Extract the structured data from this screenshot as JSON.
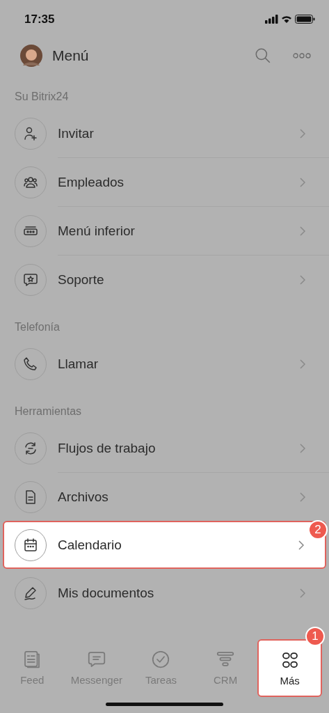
{
  "status_bar": {
    "time": "17:35"
  },
  "header": {
    "title": "Menú"
  },
  "sections": [
    {
      "title": "Su Bitrix24",
      "items": [
        {
          "label": "Invitar",
          "kind": "invite",
          "highlighted": false
        },
        {
          "label": "Empleados",
          "kind": "people",
          "highlighted": false
        },
        {
          "label": "Menú inferior",
          "kind": "bar",
          "highlighted": false
        },
        {
          "label": "Soporte",
          "kind": "support",
          "highlighted": false
        }
      ]
    },
    {
      "title": "Telefonía",
      "items": [
        {
          "label": "Llamar",
          "kind": "phone",
          "highlighted": false
        }
      ]
    },
    {
      "title": "Herramientas",
      "items": [
        {
          "label": "Flujos de trabajo",
          "kind": "flow",
          "highlighted": false
        },
        {
          "label": "Archivos",
          "kind": "file",
          "highlighted": false
        },
        {
          "label": "Calendario",
          "kind": "calendar",
          "highlighted": true,
          "badge": "2"
        },
        {
          "label": "Mis documentos",
          "kind": "sign",
          "highlighted": false
        }
      ]
    }
  ],
  "tabs": [
    {
      "label": "Feed",
      "kind": "feed",
      "selected": false,
      "highlighted": false
    },
    {
      "label": "Messenger",
      "kind": "chat",
      "selected": false,
      "highlighted": false
    },
    {
      "label": "Tareas",
      "kind": "check",
      "selected": false,
      "highlighted": false
    },
    {
      "label": "CRM",
      "kind": "funnel",
      "selected": false,
      "highlighted": false
    },
    {
      "label": "Más",
      "kind": "grid",
      "selected": true,
      "highlighted": true,
      "badge": "1"
    }
  ]
}
